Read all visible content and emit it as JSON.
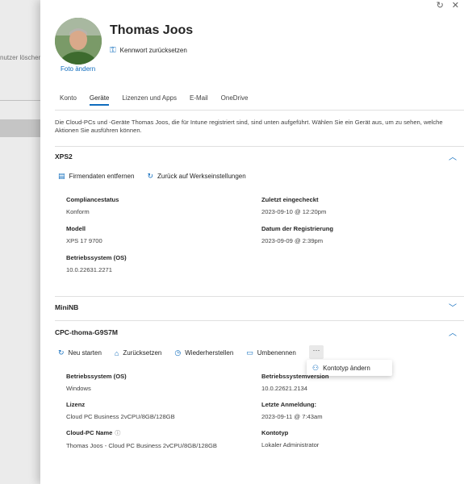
{
  "background": {
    "cut_text": "nutzer löschen"
  },
  "window": {
    "refresh_icon": "↻",
    "close_icon": "✕"
  },
  "user": {
    "name": "Thomas Joos",
    "photo_link": "Foto ändern",
    "reset_password": "Kennwort zurücksetzen"
  },
  "tabs": [
    {
      "label": "Konto",
      "active": false
    },
    {
      "label": "Geräte",
      "active": true
    },
    {
      "label": "Lizenzen und Apps",
      "active": false
    },
    {
      "label": "E-Mail",
      "active": false
    },
    {
      "label": "OneDrive",
      "active": false
    }
  ],
  "description": "Die Cloud-PCs und -Geräte Thomas Joos, die für Intune registriert sind, sind unten aufgeführt. Wählen Sie ein Gerät aus, um zu sehen, welche Aktionen Sie ausführen können.",
  "devices": {
    "xps2": {
      "title": "XPS2",
      "actions": {
        "wipe": "Firmendaten entfernen",
        "reset": "Zurück auf Werkseinstellungen"
      },
      "fields": {
        "compliance": {
          "label": "Compliancestatus",
          "value": "Konform"
        },
        "last_checkin": {
          "label": "Zuletzt eingecheckt",
          "value": "2023-09-10 @ 12:20pm"
        },
        "model": {
          "label": "Modell",
          "value": "XPS 17 9700"
        },
        "registered": {
          "label": "Datum der Registrierung",
          "value": "2023-09-09 @ 2:39pm"
        },
        "os": {
          "label": "Betriebssystem (OS)",
          "value": "10.0.22631.2271"
        }
      }
    },
    "mininb": {
      "title": "MiniNB"
    },
    "cpc": {
      "title": "CPC-thoma-G9S7M",
      "actions": {
        "restart": "Neu starten",
        "reset": "Zurücksetzen",
        "restore": "Wiederherstellen",
        "rename": "Umbenennen",
        "more": "···"
      },
      "menu": {
        "change_account_type": "Kontotyp ändern"
      },
      "fields": {
        "os": {
          "label": "Betriebssystem (OS)",
          "value": "Windows"
        },
        "os_version": {
          "label": "Betriebssystemversion",
          "value": "10.0.22621.2134"
        },
        "license": {
          "label": "Lizenz",
          "value": "Cloud PC Business 2vCPU/8GB/128GB"
        },
        "last_login": {
          "label": "Letzte Anmeldung:",
          "value": "2023-09-11 @ 7:43am"
        },
        "cloudpc_name": {
          "label": "Cloud-PC Name",
          "value": "Thomas Joos - Cloud PC Business 2vCPU/8GB/128GB"
        },
        "account_type": {
          "label": "Kontotyp",
          "value": "Lokaler Administrator"
        }
      }
    }
  },
  "colors": {
    "accent": "#0f6cbd",
    "text": "#242424"
  }
}
